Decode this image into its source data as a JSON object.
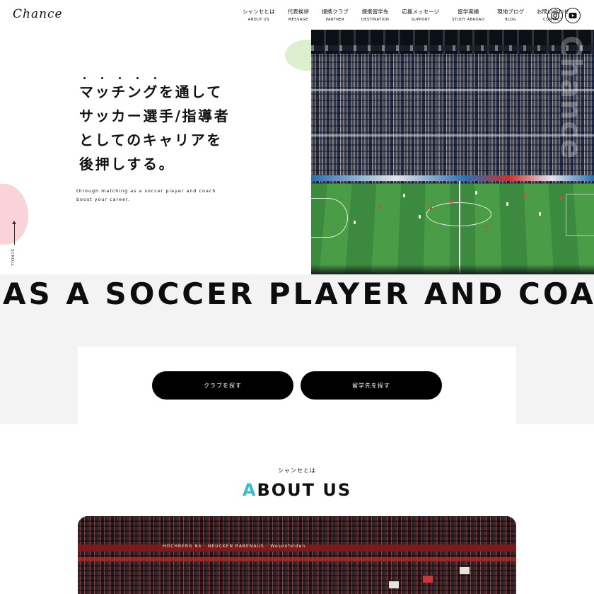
{
  "header": {
    "logo": "Chance",
    "nav": [
      {
        "jp": "シャンセとは",
        "en": "ABOUT US"
      },
      {
        "jp": "代表挨拶",
        "en": "MESSAGE"
      },
      {
        "jp": "提携クラブ",
        "en": "PARTNER"
      },
      {
        "jp": "提携留学先",
        "en": "DESTINATION"
      },
      {
        "jp": "応援メッセージ",
        "en": "SUPPORT"
      },
      {
        "jp": "留学実績",
        "en": "STUDY ABROAD"
      },
      {
        "jp": "現地ブログ",
        "en": "BLOG"
      },
      {
        "jp": "お問い合わせ",
        "en": "CONTACT"
      }
    ],
    "social": [
      "instagram-icon",
      "youtube-icon"
    ]
  },
  "hero": {
    "title_lines": [
      "マッチングを通して",
      "サッカー選手/指導者",
      "としてのキャリアを",
      "後押しする。"
    ],
    "subtitle_lines": [
      "through matching as a soccer player and coach",
      "boost your career."
    ],
    "scroll_label": "SCROLL",
    "watermark": "Chance",
    "image": "soccer-stadium-photo"
  },
  "marquee": {
    "text": "AS A SOCCER PLAYER AND COA"
  },
  "search": {
    "club_button": "クラブを探す",
    "school_button": "留学先を探す"
  },
  "about": {
    "kicker": "シャンセとは",
    "title_accent": "A",
    "title_rest": "BOUT US",
    "banner_text": "HOCHBERG 84   ·   NEUCKEN RABENAUS   ·   Wesenfelden",
    "image": "stadium-crowd-photo"
  },
  "colors": {
    "accent": "#3cbbd0",
    "button": "#000000",
    "band": "#f3f3f3",
    "blob_green": "#dcefcf",
    "blob_pink": "#f9d3d9"
  }
}
